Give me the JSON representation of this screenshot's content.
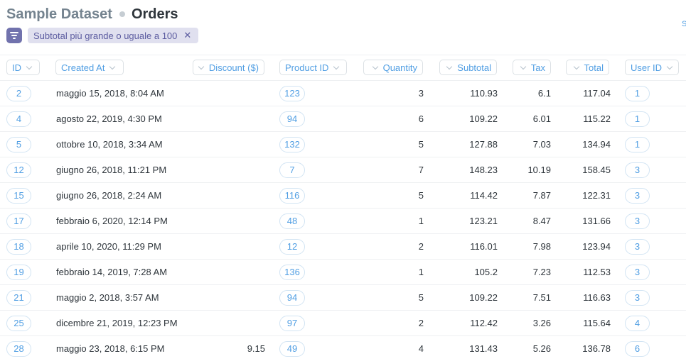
{
  "breadcrumb": {
    "database": "Sample Dataset",
    "table": "Orders"
  },
  "edge_link": "S",
  "filter": {
    "icon": "filter-icon",
    "label": "Subtotal più grande o uguale a 100",
    "remove": "✕"
  },
  "columns": {
    "id": "ID",
    "created_at": "Created At",
    "discount": "Discount ($)",
    "product_id": "Product ID",
    "quantity": "Quantity",
    "subtotal": "Subtotal",
    "tax": "Tax",
    "total": "Total",
    "user_id": "User ID"
  },
  "rows": [
    {
      "id": "2",
      "created_at": "maggio 15, 2018, 8:04 AM",
      "discount": "",
      "product_id": "123",
      "quantity": "3",
      "subtotal": "110.93",
      "tax": "6.1",
      "total": "117.04",
      "user_id": "1"
    },
    {
      "id": "4",
      "created_at": "agosto 22, 2019, 4:30 PM",
      "discount": "",
      "product_id": "94",
      "quantity": "6",
      "subtotal": "109.22",
      "tax": "6.01",
      "total": "115.22",
      "user_id": "1"
    },
    {
      "id": "5",
      "created_at": "ottobre 10, 2018, 3:34 AM",
      "discount": "",
      "product_id": "132",
      "quantity": "5",
      "subtotal": "127.88",
      "tax": "7.03",
      "total": "134.94",
      "user_id": "1"
    },
    {
      "id": "12",
      "created_at": "giugno 26, 2018, 11:21 PM",
      "discount": "",
      "product_id": "7",
      "quantity": "7",
      "subtotal": "148.23",
      "tax": "10.19",
      "total": "158.45",
      "user_id": "3"
    },
    {
      "id": "15",
      "created_at": "giugno 26, 2018, 2:24 AM",
      "discount": "",
      "product_id": "116",
      "quantity": "5",
      "subtotal": "114.42",
      "tax": "7.87",
      "total": "122.31",
      "user_id": "3"
    },
    {
      "id": "17",
      "created_at": "febbraio 6, 2020, 12:14 PM",
      "discount": "",
      "product_id": "48",
      "quantity": "1",
      "subtotal": "123.21",
      "tax": "8.47",
      "total": "131.66",
      "user_id": "3"
    },
    {
      "id": "18",
      "created_at": "aprile 10, 2020, 11:29 PM",
      "discount": "",
      "product_id": "12",
      "quantity": "2",
      "subtotal": "116.01",
      "tax": "7.98",
      "total": "123.94",
      "user_id": "3"
    },
    {
      "id": "19",
      "created_at": "febbraio 14, 2019, 7:28 AM",
      "discount": "",
      "product_id": "136",
      "quantity": "1",
      "subtotal": "105.2",
      "tax": "7.23",
      "total": "112.53",
      "user_id": "3"
    },
    {
      "id": "21",
      "created_at": "maggio 2, 2018, 3:57 AM",
      "discount": "",
      "product_id": "94",
      "quantity": "5",
      "subtotal": "109.22",
      "tax": "7.51",
      "total": "116.63",
      "user_id": "3"
    },
    {
      "id": "25",
      "created_at": "dicembre 21, 2019, 12:23 PM",
      "discount": "",
      "product_id": "97",
      "quantity": "2",
      "subtotal": "112.42",
      "tax": "3.26",
      "total": "115.64",
      "user_id": "4"
    },
    {
      "id": "28",
      "created_at": "maggio 23, 2018, 6:15 PM",
      "discount": "9.15",
      "product_id": "49",
      "quantity": "4",
      "subtotal": "131.43",
      "tax": "5.26",
      "total": "136.78",
      "user_id": "6"
    }
  ],
  "colors": {
    "brand": "#509ee3",
    "filter": "#7172ad",
    "filter_bg": "#e0e0ef",
    "text": "#2e353b",
    "muted": "#74838f"
  }
}
